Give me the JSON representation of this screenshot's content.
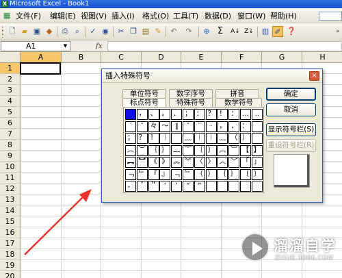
{
  "window": {
    "title": "Microsoft Excel - Book1",
    "app_icon": "excel-icon"
  },
  "menu": {
    "items": [
      "文件(F)",
      "编辑(E)",
      "视图(V)",
      "插入(I)",
      "格式(O)",
      "工具(T)",
      "数据(D)",
      "窗口(W)",
      "帮助(H)"
    ]
  },
  "toolbar": {
    "buttons": [
      "new-icon",
      "open-icon",
      "save-icon",
      "permission-icon",
      "print-icon",
      "print-preview-icon",
      "spelling-icon",
      "research-icon",
      "cut-icon",
      "copy-icon",
      "paste-icon",
      "format-painter-icon",
      "undo-icon",
      "redo-icon",
      "hyperlink-icon",
      "autosum-icon",
      "sort-ascending-icon",
      "sort-descending-icon",
      "chart-wizard-icon",
      "drawing-icon",
      "help-icon"
    ],
    "autosum_glyph": "Σ",
    "sort_asc_glyph": "A↓",
    "sort_desc_glyph": "Z↓"
  },
  "formula_bar": {
    "name_box": "A1",
    "fx_label": "fx",
    "formula": ""
  },
  "sheet": {
    "columns": [
      "A",
      "B",
      "C",
      "D",
      "E",
      "F",
      "G",
      "H"
    ],
    "rows": [
      "1",
      "2",
      "3",
      "4",
      "5",
      "6",
      "7",
      "8",
      "9",
      "10",
      "11",
      "12",
      "13",
      "14",
      "15",
      "16",
      "17",
      "18",
      "19",
      "20"
    ],
    "active_cell": "A1"
  },
  "dialog": {
    "title": "插入特殊符号",
    "close_glyph": "×",
    "tabs_row1": [
      "单位符号",
      "数字序号",
      "拼音"
    ],
    "tabs_row2": [
      "标点符号",
      "特殊符号",
      "数学符号"
    ],
    "active_tab": "标点符号",
    "symbols": [
      [
        "",
        "，",
        "、",
        "。",
        "．",
        "；",
        "：",
        "？",
        "！",
        "：",
        "…",
        "‥"
      ],
      [
        "ˊ",
        "ˇ",
        "々",
        "～",
        "‖",
        "ˇ",
        "¨",
        "·",
        "，",
        "．",
        "：",
        ""
      ],
      [
        "；",
        "？",
        "！",
        "｜",
        "｀",
        "﹏",
        "｜",
        "｜",
        "﹏",
        "（",
        "）",
        ""
      ],
      [
        "︵",
        "︶",
        "｛",
        "｝",
        "︷",
        "︸",
        "〔",
        "〕",
        "︹",
        "︺",
        "【",
        "】"
      ],
      [
        "︻",
        "︼",
        "《",
        "》",
        "︽",
        "︾",
        "〈",
        "〉",
        "︿",
        "﹀",
        "「",
        "」"
      ],
      [
        "﹁",
        "﹂",
        "『",
        "』",
        "﹃",
        "﹄",
        "（",
        "）",
        "｛",
        "｝",
        "〔",
        "〕"
      ],
      [
        "，",
        "＇",
        "＂",
        "‘",
        "’",
        "“",
        "”",
        "",
        "",
        "",
        "",
        ""
      ]
    ],
    "buttons": {
      "ok": "确定",
      "cancel": "取消",
      "show_bar": "显示符号栏(S)",
      "reset_bar": "重设符号栏(R)"
    }
  },
  "watermark": {
    "title": "溜溜自学",
    "subtitle": "ZIXUE.3D66.COM"
  },
  "colors": {
    "title_bar": "#1f5bd2",
    "selection": "#f7c66b",
    "annotation_arrow": "#e8332b",
    "selected_symbol": "#1010e0"
  }
}
